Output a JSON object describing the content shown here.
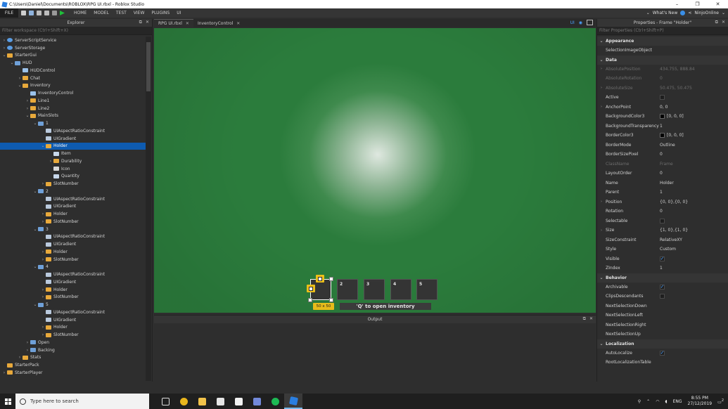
{
  "window": {
    "title": "C:\\Users\\Daniel\\Documents\\ROBLOX\\RPG UI.rbxl - Roblox Studio",
    "controls": [
      "–",
      "❐",
      "✕"
    ]
  },
  "menubar": {
    "file": "FILE",
    "items": [
      "HOME",
      "MODEL",
      "TEST",
      "VIEW",
      "PLUGINS",
      "UI"
    ],
    "whats_new": "What's New",
    "user": "NinjoOnline"
  },
  "explorer": {
    "title": "Explorer",
    "filter_placeholder": "Filter workspace (Ctrl+Shift+X)",
    "rows": [
      {
        "label": "ServerScriptService",
        "depth": 0,
        "icon": "service",
        "chev": "›"
      },
      {
        "label": "ServerStorage",
        "depth": 0,
        "icon": "service",
        "chev": "›"
      },
      {
        "label": "StarterGui",
        "depth": 0,
        "icon": "folder",
        "chev": "⌄"
      },
      {
        "label": "HUD",
        "depth": 1,
        "icon": "gui",
        "chev": "⌄"
      },
      {
        "label": "HUDControl",
        "depth": 2,
        "icon": "script",
        "chev": ""
      },
      {
        "label": "Chat",
        "depth": 2,
        "icon": "folder",
        "chev": "›"
      },
      {
        "label": "Inventory",
        "depth": 2,
        "icon": "folder",
        "chev": "⌄"
      },
      {
        "label": "InventoryControl",
        "depth": 3,
        "icon": "script",
        "chev": ""
      },
      {
        "label": "Line1",
        "depth": 3,
        "icon": "folder",
        "chev": "›"
      },
      {
        "label": "Line2",
        "depth": 3,
        "icon": "folder",
        "chev": "›"
      },
      {
        "label": "MainSlots",
        "depth": 3,
        "icon": "folder",
        "chev": "⌄"
      },
      {
        "label": "1",
        "depth": 4,
        "icon": "gui",
        "chev": "⌄"
      },
      {
        "label": "UIAspectRatioConstraint",
        "depth": 5,
        "icon": "uiobj",
        "chev": ""
      },
      {
        "label": "UIGradient",
        "depth": 5,
        "icon": "uiobj",
        "chev": ""
      },
      {
        "label": "Holder",
        "depth": 5,
        "icon": "folder",
        "chev": "⌄",
        "selected": true
      },
      {
        "label": "Item",
        "depth": 6,
        "icon": "text",
        "chev": ""
      },
      {
        "label": "Durability",
        "depth": 6,
        "icon": "folder",
        "chev": "›"
      },
      {
        "label": "Icon",
        "depth": 6,
        "icon": "image",
        "chev": ""
      },
      {
        "label": "Quantity",
        "depth": 6,
        "icon": "text",
        "chev": ""
      },
      {
        "label": "SlotNumber",
        "depth": 5,
        "icon": "folder",
        "chev": "›"
      },
      {
        "label": "2",
        "depth": 4,
        "icon": "gui",
        "chev": "⌄"
      },
      {
        "label": "UIAspectRatioConstraint",
        "depth": 5,
        "icon": "uiobj",
        "chev": ""
      },
      {
        "label": "UIGradient",
        "depth": 5,
        "icon": "uiobj",
        "chev": ""
      },
      {
        "label": "Holder",
        "depth": 5,
        "icon": "folder",
        "chev": "›"
      },
      {
        "label": "SlotNumber",
        "depth": 5,
        "icon": "folder",
        "chev": "›"
      },
      {
        "label": "3",
        "depth": 4,
        "icon": "gui",
        "chev": "⌄"
      },
      {
        "label": "UIAspectRatioConstraint",
        "depth": 5,
        "icon": "uiobj",
        "chev": ""
      },
      {
        "label": "UIGradient",
        "depth": 5,
        "icon": "uiobj",
        "chev": ""
      },
      {
        "label": "Holder",
        "depth": 5,
        "icon": "folder",
        "chev": "›"
      },
      {
        "label": "SlotNumber",
        "depth": 5,
        "icon": "folder",
        "chev": "›"
      },
      {
        "label": "4",
        "depth": 4,
        "icon": "gui",
        "chev": "⌄"
      },
      {
        "label": "UIAspectRatioConstraint",
        "depth": 5,
        "icon": "uiobj",
        "chev": ""
      },
      {
        "label": "UIGradient",
        "depth": 5,
        "icon": "uiobj",
        "chev": ""
      },
      {
        "label": "Holder",
        "depth": 5,
        "icon": "folder",
        "chev": "›"
      },
      {
        "label": "SlotNumber",
        "depth": 5,
        "icon": "folder",
        "chev": "›"
      },
      {
        "label": "5",
        "depth": 4,
        "icon": "gui",
        "chev": "⌄"
      },
      {
        "label": "UIAspectRatioConstraint",
        "depth": 5,
        "icon": "uiobj",
        "chev": ""
      },
      {
        "label": "UIGradient",
        "depth": 5,
        "icon": "uiobj",
        "chev": ""
      },
      {
        "label": "Holder",
        "depth": 5,
        "icon": "folder",
        "chev": "›"
      },
      {
        "label": "SlotNumber",
        "depth": 5,
        "icon": "folder",
        "chev": "›"
      },
      {
        "label": "Open",
        "depth": 3,
        "icon": "gui",
        "chev": "›"
      },
      {
        "label": "Backing",
        "depth": 3,
        "icon": "gui",
        "chev": "›"
      },
      {
        "label": "Stats",
        "depth": 2,
        "icon": "folder",
        "chev": "›"
      },
      {
        "label": "StarterPack",
        "depth": 0,
        "icon": "folder",
        "chev": ""
      },
      {
        "label": "StarterPlayer",
        "depth": 0,
        "icon": "folder",
        "chev": "›"
      }
    ]
  },
  "tabs": [
    {
      "label": "RPG UI.rbxl",
      "active": true
    },
    {
      "label": "InventoryControl",
      "active": false
    }
  ],
  "tabs_right": {
    "ui_label": "UI"
  },
  "viewport": {
    "slots": [
      "",
      "2",
      "3",
      "4",
      "5"
    ],
    "size_badge": "50 x 50",
    "hint": "'Q' to open inventory"
  },
  "output": {
    "title": "Output"
  },
  "properties": {
    "title": "Properties - Frame \"Holder\"",
    "filter_placeholder": "Filter Properties (Ctrl+Shift+P)",
    "sections": [
      {
        "name": "Appearance",
        "rows": [
          {
            "name": "SelectionImageObject",
            "value": ""
          }
        ]
      },
      {
        "name": "Data",
        "rows": [
          {
            "name": "AbsolutePosition",
            "value": "434.755, 888.84",
            "dim": true,
            "expand": true
          },
          {
            "name": "AbsoluteRotation",
            "value": "0",
            "dim": true
          },
          {
            "name": "AbsoluteSize",
            "value": "50.475, 50.475",
            "dim": true,
            "expand": true
          },
          {
            "name": "Active",
            "check": false
          },
          {
            "name": "AnchorPoint",
            "value": "0, 0",
            "expand": true
          },
          {
            "name": "BackgroundColor3",
            "value": "[0, 0, 0]",
            "swatch": "#000000"
          },
          {
            "name": "BackgroundTransparency",
            "value": "1"
          },
          {
            "name": "BorderColor3",
            "value": "[0, 0, 0]",
            "swatch": "#000000"
          },
          {
            "name": "BorderMode",
            "value": "Outline"
          },
          {
            "name": "BorderSizePixel",
            "value": "0"
          },
          {
            "name": "ClassName",
            "value": "Frame",
            "dim": true
          },
          {
            "name": "LayoutOrder",
            "value": "0"
          },
          {
            "name": "Name",
            "value": "Holder"
          },
          {
            "name": "Parent",
            "value": "1"
          },
          {
            "name": "Position",
            "value": "{0, 0},{0, 0}",
            "expand": true
          },
          {
            "name": "Rotation",
            "value": "0"
          },
          {
            "name": "Selectable",
            "check": false
          },
          {
            "name": "Size",
            "value": "{1, 0},{1, 0}",
            "expand": true
          },
          {
            "name": "SizeConstraint",
            "value": "RelativeXY"
          },
          {
            "name": "Style",
            "value": "Custom"
          },
          {
            "name": "Visible",
            "check": true
          },
          {
            "name": "ZIndex",
            "value": "1"
          }
        ]
      },
      {
        "name": "Behavior",
        "rows": [
          {
            "name": "Archivable",
            "check": true
          },
          {
            "name": "ClipsDescendants",
            "check": false
          },
          {
            "name": "NextSelectionDown",
            "value": ""
          },
          {
            "name": "NextSelectionLeft",
            "value": ""
          },
          {
            "name": "NextSelectionRight",
            "value": ""
          },
          {
            "name": "NextSelectionUp",
            "value": ""
          }
        ]
      },
      {
        "name": "Localization",
        "rows": [
          {
            "name": "AutoLocalize",
            "check": true
          },
          {
            "name": "RootLocalizationTable",
            "value": ""
          }
        ]
      }
    ]
  },
  "taskbar": {
    "search_placeholder": "Type here to search",
    "lang": "ENG",
    "time": "8:55 PM",
    "date": "27/12/2019",
    "notifications": "2"
  },
  "colors": {
    "selection": "#0e5bb0",
    "accent": "#4aa1ff",
    "viewport_green": "#2b7c3c",
    "handle_yellow": "#f0c21b"
  }
}
